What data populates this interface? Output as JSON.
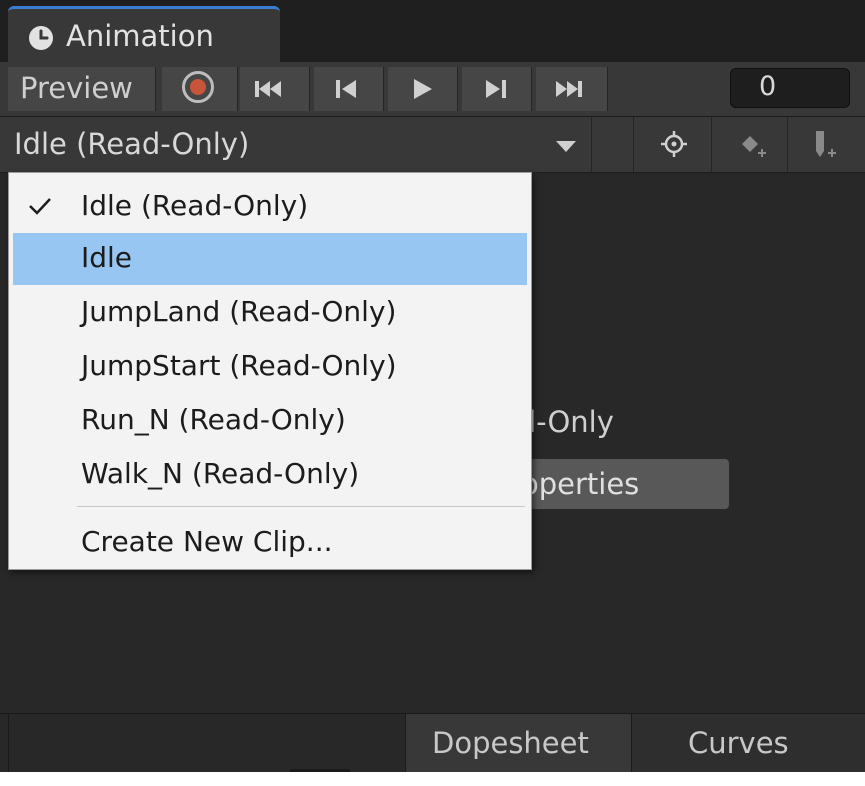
{
  "window": {
    "tab_title": "Animation"
  },
  "toolbar": {
    "preview_label": "Preview",
    "frame_value": "0"
  },
  "clip": {
    "selected": "Idle (Read-Only)"
  },
  "menu": {
    "items": [
      {
        "label": "Idle (Read-Only)",
        "checked": true,
        "highlighted": false
      },
      {
        "label": "Idle",
        "checked": false,
        "highlighted": true
      },
      {
        "label": "JumpLand (Read-Only)",
        "checked": false,
        "highlighted": false
      },
      {
        "label": "JumpStart (Read-Only)",
        "checked": false,
        "highlighted": false
      },
      {
        "label": "Run_N (Read-Only)",
        "checked": false,
        "highlighted": false
      },
      {
        "label": "Walk_N (Read-Only)",
        "checked": false,
        "highlighted": false
      }
    ],
    "create_label": "Create New Clip..."
  },
  "body": {
    "partial_text": "ad-Only",
    "partial_button": "operties"
  },
  "bottom_tabs": {
    "dopesheet": "Dopesheet",
    "curves": "Curves"
  },
  "colors": {
    "panel_bg": "#282828",
    "toolbar_bg": "#383838",
    "accent": "#3b7fd4",
    "record": "#c8553a",
    "menu_bg": "#f3f3f3",
    "menu_highlight": "#98c6f2"
  }
}
